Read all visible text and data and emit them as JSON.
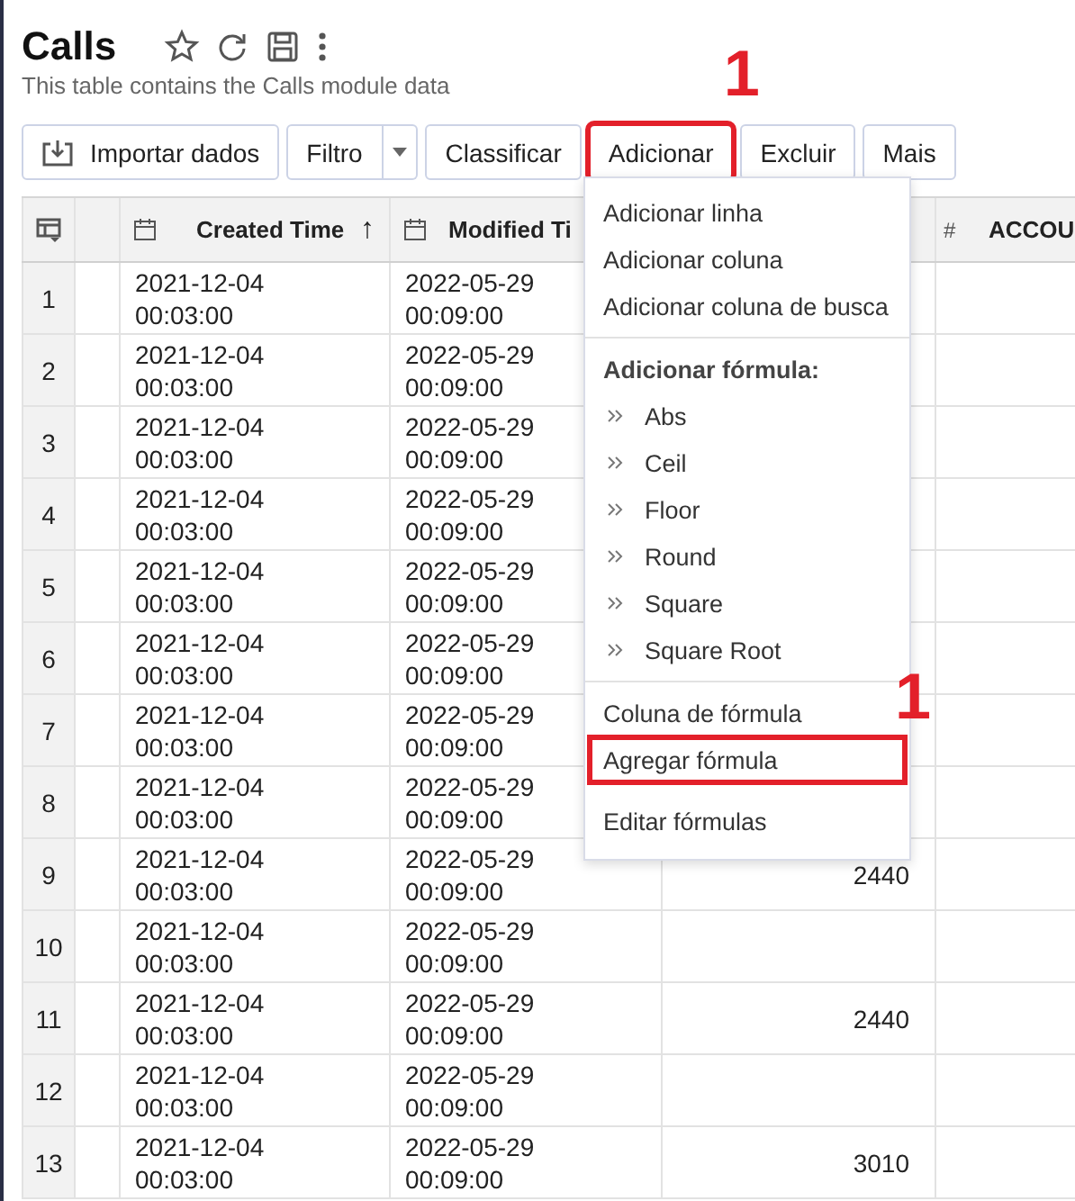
{
  "page": {
    "title": "Calls",
    "subtitle": "This table contains the Calls module data"
  },
  "toolbar": [
    {
      "label": "Importar dados",
      "kind": "import",
      "highlighted": false
    },
    {
      "label": "Filtro",
      "kind": "split",
      "highlighted": false
    },
    {
      "label": "Classificar",
      "kind": "plain",
      "highlighted": false
    },
    {
      "label": "Adicionar",
      "kind": "plain",
      "highlighted": true,
      "callout": "1"
    },
    {
      "label": "Excluir",
      "kind": "plain",
      "highlighted": false
    },
    {
      "label": "Mais",
      "kind": "plain",
      "highlighted": false
    }
  ],
  "table": {
    "columns": [
      {
        "label": "Created Time",
        "kind": "date",
        "sort_mark": "↑"
      },
      {
        "label": "Modified Ti",
        "kind": "date"
      },
      {
        "kind": "hidden"
      },
      {
        "label": "ACCOU",
        "kind": "number",
        "type_mark": "#"
      }
    ],
    "rows": [
      {
        "num": "1",
        "cells": [
          "2021-12-04 00:03:00",
          "2022-05-29 00:09:00"
        ]
      },
      {
        "num": "2",
        "cells": [
          "2021-12-04 00:03:00",
          "2022-05-29 00:09:00"
        ]
      },
      {
        "num": "3",
        "cells": [
          "2021-12-04 00:03:00",
          "2022-05-29 00:09:00"
        ]
      },
      {
        "num": "4",
        "cells": [
          "2021-12-04 00:03:00",
          "2022-05-29 00:09:00"
        ]
      },
      {
        "num": "5",
        "cells": [
          "2021-12-04 00:03:00",
          "2022-05-29 00:09:00"
        ]
      },
      {
        "num": "6",
        "cells": [
          "2021-12-04 00:03:00",
          "2022-05-29 00:09:00"
        ]
      },
      {
        "num": "7",
        "cells": [
          "2021-12-04 00:03:00",
          "2022-05-29 00:09:00"
        ]
      },
      {
        "num": "8",
        "cells": [
          "2021-12-04 00:03:00",
          "2022-05-29 00:09:00"
        ]
      },
      {
        "num": "9",
        "cells": [
          "2021-12-04 00:03:00",
          "2022-05-29 00:09:00",
          "2440"
        ]
      },
      {
        "num": "10",
        "cells": [
          "2021-12-04 00:03:00",
          "2022-05-29 00:09:00"
        ]
      },
      {
        "num": "11",
        "cells": [
          "2021-12-04 00:03:00",
          "2022-05-29 00:09:00",
          "2440"
        ]
      },
      {
        "num": "12",
        "cells": [
          "2021-12-04 00:03:00",
          "2022-05-29 00:09:00"
        ]
      },
      {
        "num": "13",
        "cells": [
          "2021-12-04 00:03:00",
          "2022-05-29 00:09:00",
          "3010"
        ]
      }
    ]
  },
  "menu": {
    "groups": [
      {
        "items": [
          {
            "label": "Adicionar linha",
            "kind": "item",
            "highlighted": false
          },
          {
            "label": "Adicionar coluna",
            "kind": "item",
            "highlighted": false
          },
          {
            "label": "Adicionar coluna de busca",
            "kind": "item",
            "highlighted": false
          }
        ]
      },
      {
        "items": [
          {
            "label": "Adicionar fórmula:",
            "kind": "header",
            "highlighted": false
          },
          {
            "label": "Abs",
            "kind": "sub",
            "highlighted": false
          },
          {
            "label": "Ceil",
            "kind": "sub",
            "highlighted": false
          },
          {
            "label": "Floor",
            "kind": "sub",
            "highlighted": false
          },
          {
            "label": "Round",
            "kind": "sub",
            "highlighted": false
          },
          {
            "label": "Square",
            "kind": "sub",
            "highlighted": false
          },
          {
            "label": "Square Root",
            "kind": "sub",
            "highlighted": false
          }
        ]
      },
      {
        "items": [
          {
            "label": "Coluna de fórmula",
            "kind": "item",
            "highlighted": false
          },
          {
            "label": "Agregar fórmula",
            "kind": "item",
            "highlighted": true,
            "callout": "1"
          },
          {
            "label": "Editar fórmulas",
            "kind": "item",
            "highlighted": false
          }
        ]
      }
    ]
  }
}
